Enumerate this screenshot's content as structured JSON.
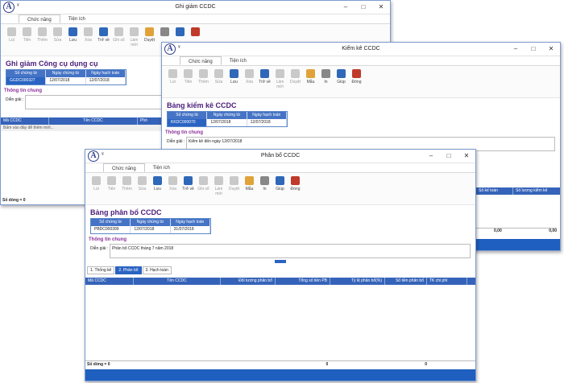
{
  "qa_glyph": "¥",
  "win_controls": [
    "–",
    "□",
    "✕"
  ],
  "w1": {
    "title": "Ghi giảm CCDC",
    "tabs": [
      "Chức năng",
      "Tiện ích"
    ],
    "toolbar": [
      "Lùi",
      "Tiến",
      "Thêm",
      "Sửa",
      "Lưu",
      "Xóa",
      "Trở về",
      "Ghi sổ",
      "Làm mới",
      "Duyệt"
    ],
    "heading": "Ghi giảm Công cụ dụng cụ",
    "headers": [
      "Số chứng từ",
      "Ngày chứng từ",
      "Ngày hạch toán"
    ],
    "values": [
      "GGDC000327",
      "12/07/2018",
      "12/07/2018"
    ],
    "section": "Thông tin chung",
    "desc_label": "Diễn giải :",
    "grid_cols": [
      "Mã CCDC",
      "Tên CCDC",
      "Phò"
    ],
    "hint": "Bấm vào đây để thêm mới...",
    "status": "Số dòng = 0"
  },
  "w2": {
    "title": "Kiểm kê CCDC",
    "tabs": [
      "Chức năng",
      "Tiện ích"
    ],
    "toolbar": [
      "Lùi",
      "Tiến",
      "Thêm",
      "Sửa",
      "Lưu",
      "Xóa",
      "Trở về",
      "Làm mới",
      "Duyệt",
      "Mẫu",
      "In",
      "Giúp",
      "Đóng"
    ],
    "heading": "Bảng kiểm kê CCDC",
    "headers": [
      "Số chứng từ",
      "Ngày chứng từ",
      "Ngày hạch toán"
    ],
    "values": [
      "KKDC000070",
      "12/07/2018",
      "12/07/2018"
    ],
    "section": "Thông tin chung",
    "desc_label": "Diễn giải :",
    "desc_value": "Kiểm kê đến ngày 12/07/2018",
    "grid_cols": [
      "Số kế toán",
      "Số lượng kiểm kê"
    ],
    "totals": [
      "0,00",
      "0,00"
    ]
  },
  "w3": {
    "title": "Phân bổ CCDC",
    "tabs": [
      "Chức năng",
      "Tiện ích"
    ],
    "toolbar": [
      "Lùi",
      "Tiến",
      "Thêm",
      "Sửa",
      "Lưu",
      "Xóa",
      "Trở về",
      "Ghi sổ",
      "Làm mới",
      "Duyệt",
      "Mẫu",
      "In",
      "Giúp",
      "Đóng"
    ],
    "heading": "Bảng phân bổ CCDC",
    "headers": [
      "Số chứng từ",
      "Ngày chứng từ",
      "Ngày hạch toán"
    ],
    "values": [
      "PBDC000399",
      "12/07/2018",
      "31/07/2018"
    ],
    "section": "Thông tin chung",
    "desc_label": "Diễn giải :",
    "desc_value": "Phân bổ CCDC tháng 7 năm 2018",
    "bottom_tabs": [
      "1. Thống kê",
      "2. Phân bổ",
      "3. Hạch toán"
    ],
    "grid_cols": [
      "Mã CCDC",
      "Tên CCDC",
      "Đối tượng phân bổ",
      "Tổng số tiền PB",
      "Tỷ lệ phân bổ(%)",
      "Số tiền phân bổ",
      "TK chi phí"
    ],
    "totals": [
      "0",
      "0"
    ],
    "status": "Số dòng = 0"
  }
}
